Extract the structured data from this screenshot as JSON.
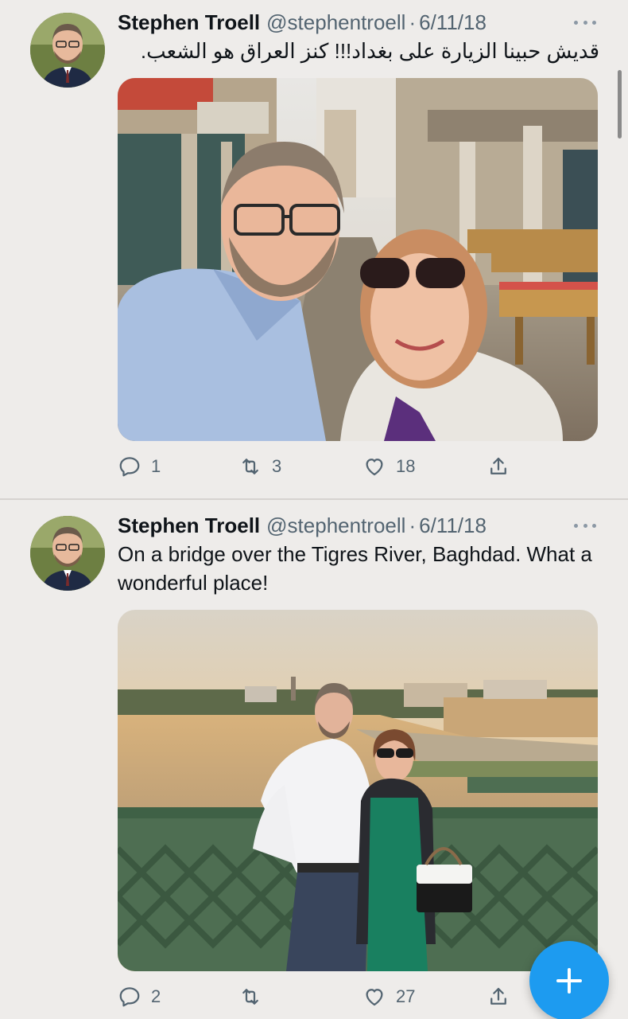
{
  "tweets": [
    {
      "author": {
        "name": "Stephen Troell",
        "handle": "@stephentroell"
      },
      "separator": "·",
      "date": "6/11/18",
      "text": "قديش حبينا الزيارة على بغداد!!! كنز العراق هو الشعب.",
      "media": {
        "description_icon": "photo-selfie-baghdad-market"
      },
      "metrics": {
        "replies": "1",
        "retweets": "3",
        "likes": "18"
      }
    },
    {
      "author": {
        "name": "Stephen Troell",
        "handle": "@stephentroell"
      },
      "separator": "·",
      "date": "6/11/18",
      "text": "On a bridge over the Tigres River, Baghdad. What a wonderful place!",
      "media": {
        "description_icon": "photo-couple-bridge-tigris"
      },
      "metrics": {
        "replies": "2",
        "retweets": "",
        "likes": "27"
      }
    }
  ],
  "icons": {
    "more": "more-horizontal-icon",
    "reply": "reply-icon",
    "retweet": "retweet-icon",
    "like": "heart-icon",
    "share": "share-icon",
    "compose": "plus-icon"
  },
  "colors": {
    "background": "#eeecea",
    "accent": "#1d9bf0",
    "muted": "#536471"
  }
}
